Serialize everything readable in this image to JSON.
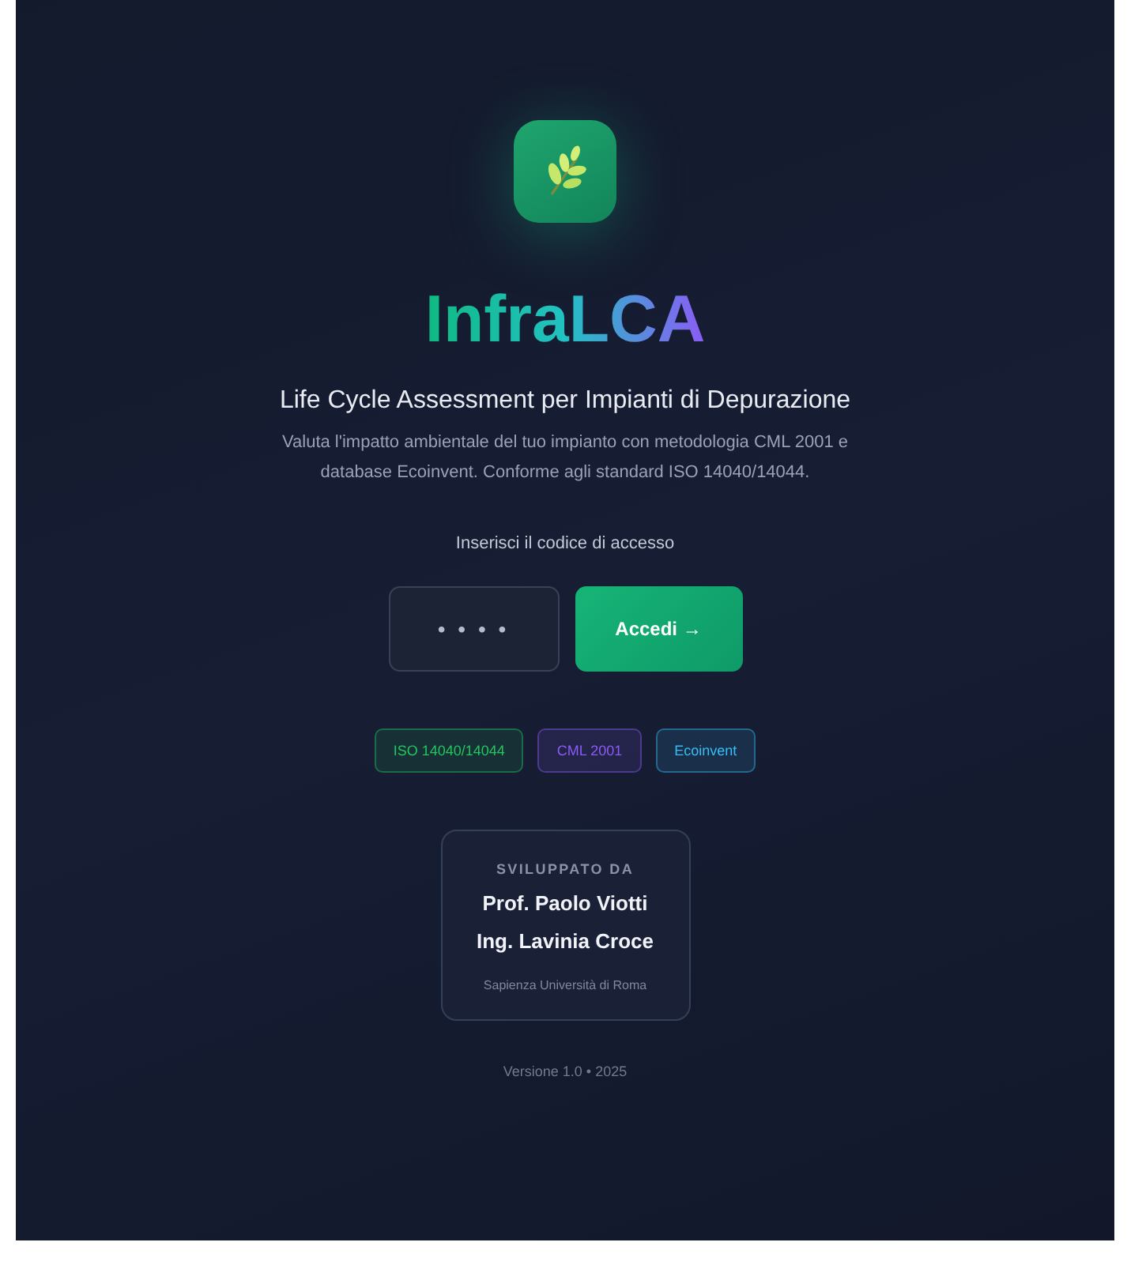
{
  "app": {
    "name": "InfraLCA",
    "subtitle": "Life Cycle Assessment per Impianti di Depurazione",
    "description": "Valuta l'impatto ambientale del tuo impianto con metodologia CML 2001 e database Ecoinvent. Conforme agli standard ISO 14040/14044."
  },
  "login": {
    "label": "Inserisci il codice di accesso",
    "placeholder": "• • • •",
    "button": "Accedi →"
  },
  "tags": [
    {
      "label": "ISO 14040/14044",
      "color": "#22c55e"
    },
    {
      "label": "CML 2001",
      "color": "#8b5cf6"
    },
    {
      "label": "Ecoinvent",
      "color": "#38bdf8"
    }
  ],
  "credits": {
    "heading": "SVILUPPATO DA",
    "authors": [
      "Prof. Paolo Viotti",
      "Ing. Lavinia Croce"
    ],
    "affiliation": "Sapienza Università di Roma"
  },
  "version": "Versione 1.0 • 2025"
}
